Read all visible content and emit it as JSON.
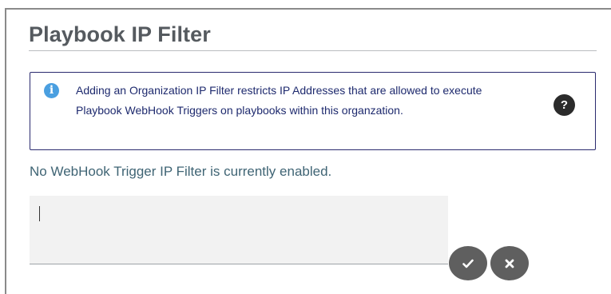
{
  "header": {
    "title": "Playbook IP Filter"
  },
  "info": {
    "icon": "info-icon",
    "line1": "Adding an Organization IP Filter restricts IP Addresses that are allowed to execute",
    "line2": "Playbook WebHook Triggers on playbooks within this organzation.",
    "help_icon": "help-icon",
    "help_glyph": "?",
    "info_glyph": "i"
  },
  "status": {
    "text": "No WebHook Trigger IP Filter is currently enabled."
  },
  "ip_filter": {
    "value": "",
    "placeholder": ""
  },
  "actions": {
    "confirm_icon": "check-icon",
    "cancel_icon": "close-icon"
  },
  "colors": {
    "title": "#555a5f",
    "info_border": "#2a2a6e",
    "info_text": "#1e2a6e",
    "info_icon": "#4a9fe0",
    "status_text": "#3f6474",
    "input_background": "#f2f2f2",
    "action_button": "#5f5f5f"
  }
}
